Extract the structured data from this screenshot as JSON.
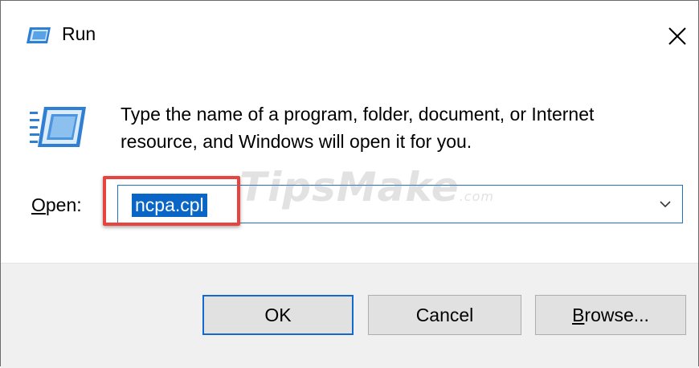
{
  "window": {
    "title": "Run",
    "title_icon": "run-icon",
    "close_glyph": "✕"
  },
  "dialog": {
    "description_line1": "Type the name of a program, folder, document, or Internet",
    "description_line2": "resource, and Windows will open it for you.",
    "open_label_first": "O",
    "open_label_rest": "pen:",
    "open_value": "ncpa.cpl"
  },
  "watermark": {
    "text": "TipsMake",
    "suffix": ".com"
  },
  "buttons": {
    "ok": "OK",
    "cancel": "Cancel",
    "browse_first": "B",
    "browse_rest": "rowse..."
  },
  "colors": {
    "accent": "#0f6bcc",
    "selection": "#0a66c6",
    "highlight_box": "#e8443f",
    "footer_bg": "#f0f0f0"
  }
}
